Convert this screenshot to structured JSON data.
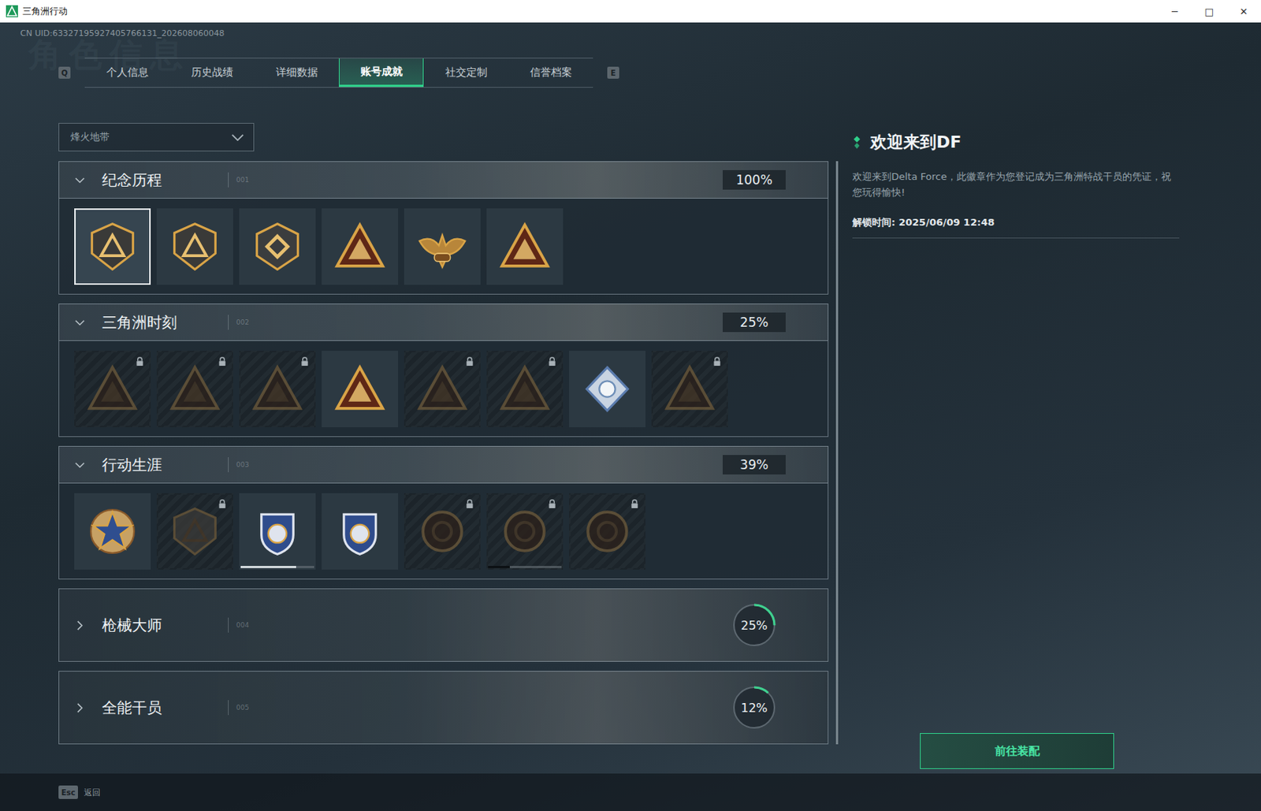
{
  "window": {
    "title": "三角洲行动",
    "controls": [
      "─",
      "□",
      "✕"
    ]
  },
  "uid": "CN UID:63327195927405766131_202608060048",
  "watermark": "角色信息",
  "tabs": {
    "prev_key": "Q",
    "next_key": "E",
    "items": [
      {
        "label": "个人信息",
        "selected": false
      },
      {
        "label": "历史战绩",
        "selected": false
      },
      {
        "label": "详细数据",
        "selected": false
      },
      {
        "label": "账号成就",
        "selected": true
      },
      {
        "label": "社交定制",
        "selected": false
      },
      {
        "label": "信誉档案",
        "selected": false
      }
    ]
  },
  "mode_select": {
    "value": "烽火地带",
    "open": false
  },
  "sections": [
    {
      "title": "纪念历程",
      "index": "001",
      "percent": "100%",
      "expanded": true,
      "badges": [
        {
          "kind": "shield",
          "locked": false,
          "selected": true
        },
        {
          "kind": "shield",
          "locked": false,
          "selected": false
        },
        {
          "kind": "hex",
          "locked": false,
          "selected": false
        },
        {
          "kind": "triangle",
          "locked": false,
          "selected": false
        },
        {
          "kind": "eagle",
          "locked": false,
          "selected": false
        },
        {
          "kind": "triangle",
          "locked": false,
          "selected": false
        }
      ]
    },
    {
      "title": "三角洲时刻",
      "index": "002",
      "percent": "25%",
      "expanded": true,
      "badges": [
        {
          "kind": "triangle",
          "locked": true,
          "selected": false
        },
        {
          "kind": "triangle",
          "locked": true,
          "selected": false
        },
        {
          "kind": "triangle",
          "locked": true,
          "selected": false
        },
        {
          "kind": "triangle",
          "locked": false,
          "selected": false
        },
        {
          "kind": "triangle",
          "locked": true,
          "selected": false
        },
        {
          "kind": "triangle",
          "locked": true,
          "selected": false
        },
        {
          "kind": "diamond",
          "locked": false,
          "selected": false
        },
        {
          "kind": "triangle",
          "locked": true,
          "selected": false
        }
      ]
    },
    {
      "title": "行动生涯",
      "index": "003",
      "percent": "39%",
      "expanded": true,
      "badges": [
        {
          "kind": "star",
          "locked": false,
          "selected": false
        },
        {
          "kind": "shield",
          "locked": true,
          "selected": false
        },
        {
          "kind": "crest",
          "locked": false,
          "selected": false,
          "level": 0.75
        },
        {
          "kind": "crest",
          "locked": false,
          "selected": false
        },
        {
          "kind": "round",
          "locked": true,
          "selected": false
        },
        {
          "kind": "round",
          "locked": true,
          "selected": false,
          "level": 0.3
        },
        {
          "kind": "round",
          "locked": true,
          "selected": false
        }
      ]
    },
    {
      "title": "枪械大师",
      "index": "004",
      "percent": "25%",
      "expanded": false,
      "level": 0.25,
      "badges": []
    },
    {
      "title": "全能干员",
      "index": "005",
      "percent": "12%",
      "expanded": false,
      "level": 0.12,
      "badges": []
    }
  ],
  "detail": {
    "title": "欢迎来到DF",
    "description": "欢迎来到Delta Force，此徽章作为您登记成为三角洲特战干员的凭证，祝您玩得愉快!",
    "unlock_time": "解锁时间: 2025/06/09 12:48"
  },
  "equip_button": "前往装配",
  "footer": {
    "key": "Esc",
    "label": "返回"
  }
}
